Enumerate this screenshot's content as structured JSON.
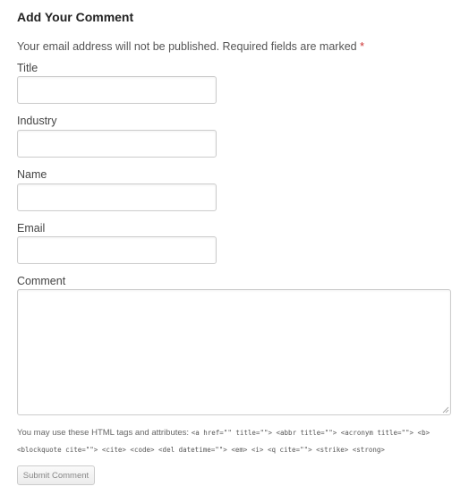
{
  "form": {
    "heading": "Add Your Comment",
    "notes_text": "Your email address will not be published. Required fields are marked ",
    "required_marker": "*",
    "fields": [
      {
        "label": "Title",
        "value": ""
      },
      {
        "label": "Industry",
        "value": ""
      },
      {
        "label": "Name",
        "value": ""
      },
      {
        "label": "Email",
        "value": ""
      }
    ],
    "comment": {
      "label": "Comment",
      "value": ""
    },
    "allowed_tags_intro": "You may use these HTML tags and attributes: ",
    "allowed_tags": "<a href=\"\" title=\"\"> <abbr title=\"\"> <acronym title=\"\"> <b> <blockquote cite=\"\"> <cite> <code> <del datetime=\"\"> <em> <i> <q cite=\"\"> <strike> <strong>",
    "submit_label": "Submit Comment"
  },
  "colors": {
    "required": "#cc3333",
    "border": "#cccccc",
    "text": "#444444"
  }
}
